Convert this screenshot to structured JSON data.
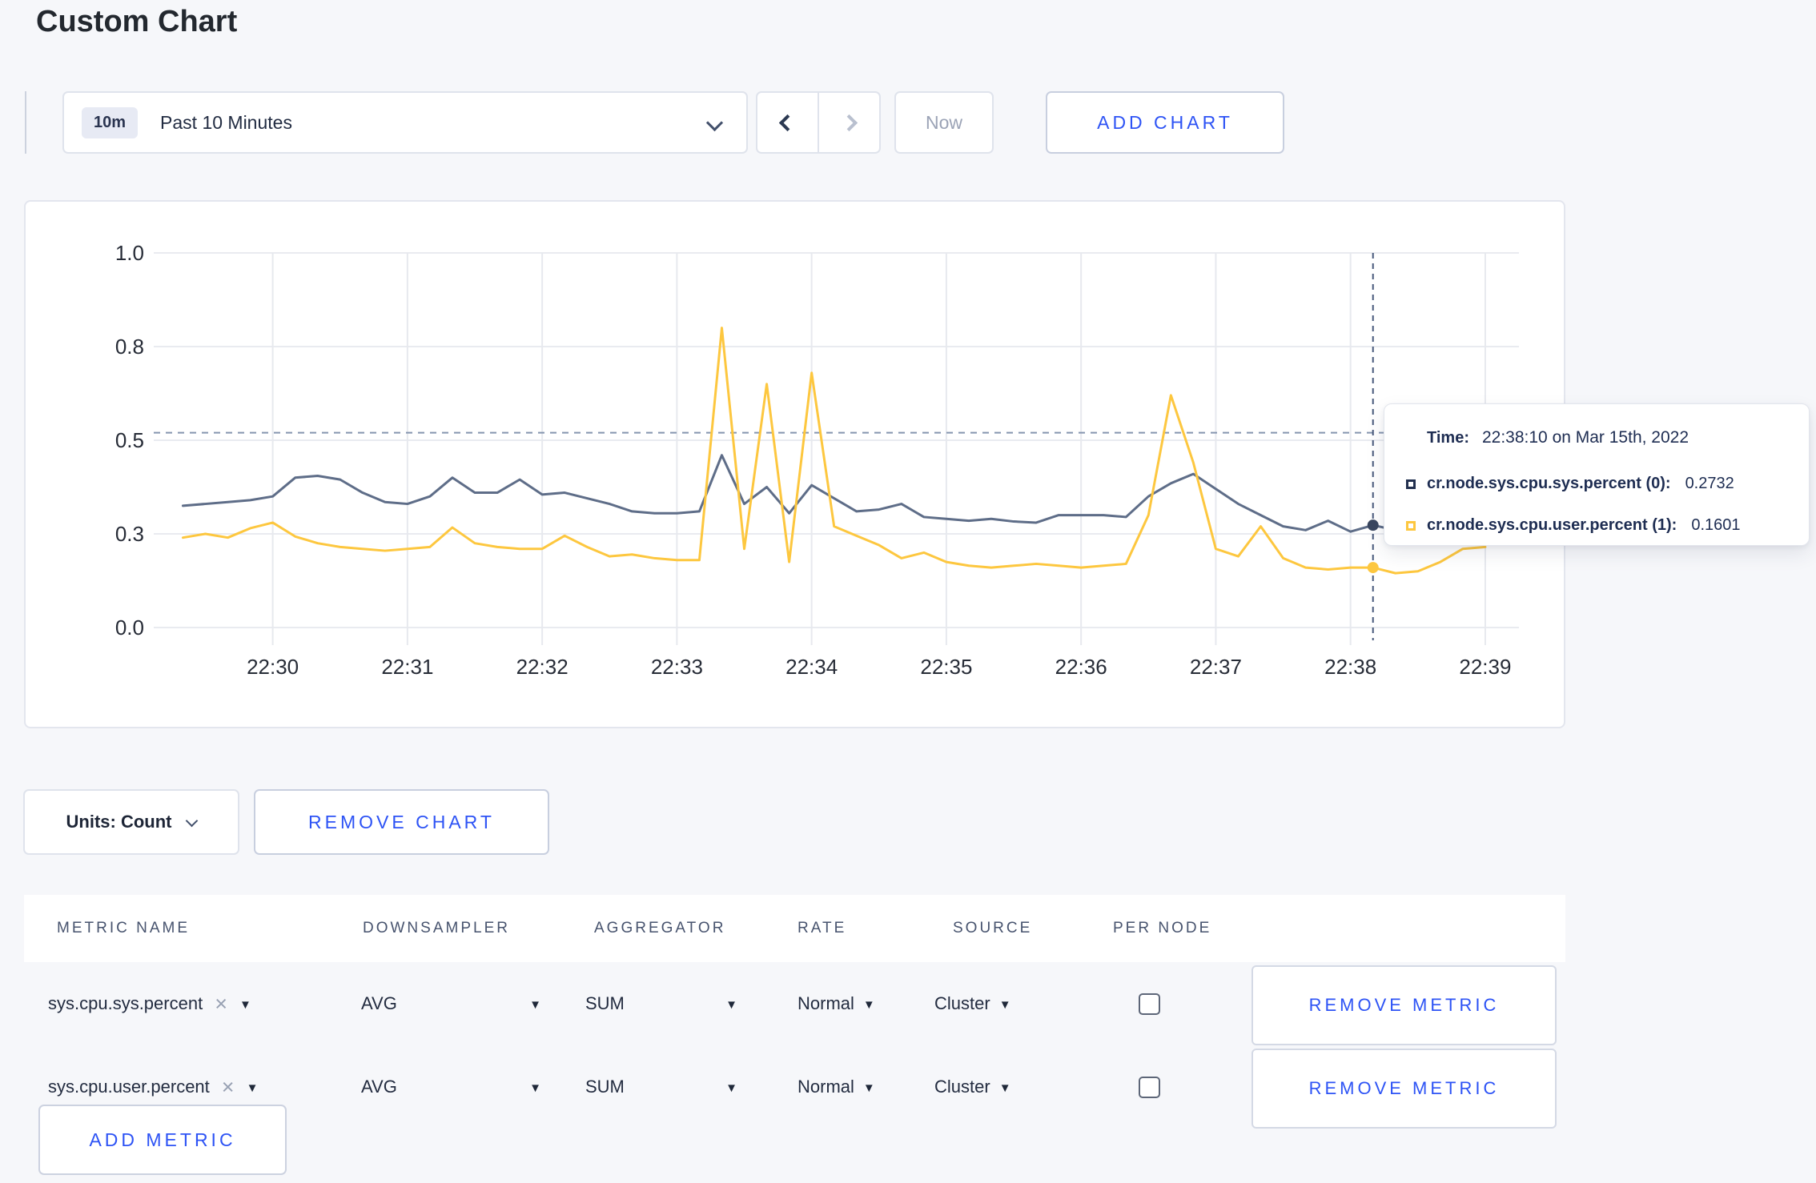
{
  "page": {
    "title": "Custom Chart",
    "background": "#f6f7fa",
    "accent_blue": "#2d53f5"
  },
  "icons": {
    "caret_down": "▼",
    "close": "×"
  },
  "toolbar": {
    "time_range": {
      "badge": "10m",
      "label": "Past 10 Minutes"
    },
    "now_label": "Now",
    "add_chart_label": "ADD CHART"
  },
  "chart_controls": {
    "units_label": "Units: Count",
    "remove_chart_label": "REMOVE CHART"
  },
  "tooltip": {
    "time_label": "Time:",
    "time_value": "22:38:10 on Mar 15th, 2022",
    "rows": [
      {
        "label": "cr.node.sys.cpu.sys.percent (0):",
        "value": "0.2732",
        "swatch_color": "#22304f"
      },
      {
        "label": "cr.node.sys.cpu.user.percent (1):",
        "value": "0.1601",
        "swatch_color": "#fdc73f"
      }
    ]
  },
  "chart_data": {
    "type": "line",
    "title": "",
    "xlabel": "",
    "ylabel": "",
    "grid": true,
    "legend_position": "tooltip",
    "x_axis": {
      "base_time": "22:29:00",
      "domain_seconds": [
        7,
        615
      ],
      "ticks": [
        {
          "s": 60,
          "label": "22:30"
        },
        {
          "s": 120,
          "label": "22:31"
        },
        {
          "s": 180,
          "label": "22:32"
        },
        {
          "s": 240,
          "label": "22:33"
        },
        {
          "s": 300,
          "label": "22:34"
        },
        {
          "s": 360,
          "label": "22:35"
        },
        {
          "s": 420,
          "label": "22:36"
        },
        {
          "s": 480,
          "label": "22:37"
        },
        {
          "s": 540,
          "label": "22:38"
        },
        {
          "s": 600,
          "label": "22:39"
        }
      ]
    },
    "y_axis": {
      "domain": [
        0,
        1
      ],
      "ticks": [
        {
          "v": 0.0,
          "label": "0.0"
        },
        {
          "v": 0.25,
          "label": "0.3"
        },
        {
          "v": 0.5,
          "label": "0.5"
        },
        {
          "v": 0.75,
          "label": "0.8"
        },
        {
          "v": 1.0,
          "label": "1.0"
        }
      ]
    },
    "x_seconds": [
      20,
      30,
      40,
      50,
      60,
      70,
      80,
      90,
      100,
      110,
      120,
      130,
      140,
      150,
      160,
      170,
      180,
      190,
      200,
      210,
      220,
      230,
      240,
      250,
      260,
      270,
      280,
      290,
      300,
      310,
      320,
      330,
      340,
      350,
      360,
      370,
      380,
      390,
      400,
      410,
      420,
      430,
      440,
      450,
      460,
      470,
      480,
      490,
      500,
      510,
      520,
      530,
      540,
      550,
      560,
      570,
      580,
      590,
      600
    ],
    "series": [
      {
        "name": "cr.node.sys.cpu.sys.percent",
        "color": "#5e6d88",
        "values": [
          0.325,
          0.33,
          0.335,
          0.34,
          0.35,
          0.4,
          0.405,
          0.395,
          0.36,
          0.335,
          0.33,
          0.35,
          0.4,
          0.36,
          0.36,
          0.395,
          0.355,
          0.36,
          0.345,
          0.33,
          0.31,
          0.305,
          0.305,
          0.31,
          0.46,
          0.33,
          0.375,
          0.305,
          0.38,
          0.345,
          0.31,
          0.315,
          0.33,
          0.295,
          0.29,
          0.285,
          0.29,
          0.283,
          0.28,
          0.3,
          0.3,
          0.3,
          0.295,
          0.35,
          0.385,
          0.41,
          0.37,
          0.33,
          0.3,
          0.27,
          0.26,
          0.285,
          0.256,
          0.2732,
          0.26,
          0.27,
          0.28,
          0.29,
          0.3
        ]
      },
      {
        "name": "cr.node.sys.cpu.user.percent",
        "color": "#fdc73f",
        "values": [
          0.24,
          0.25,
          0.24,
          0.265,
          0.28,
          0.243,
          0.225,
          0.215,
          0.21,
          0.205,
          0.21,
          0.215,
          0.267,
          0.225,
          0.215,
          0.21,
          0.21,
          0.245,
          0.215,
          0.19,
          0.195,
          0.185,
          0.18,
          0.18,
          0.8,
          0.21,
          0.65,
          0.175,
          0.68,
          0.27,
          0.245,
          0.22,
          0.185,
          0.2,
          0.175,
          0.165,
          0.16,
          0.165,
          0.17,
          0.165,
          0.16,
          0.165,
          0.17,
          0.3,
          0.62,
          0.44,
          0.21,
          0.19,
          0.27,
          0.185,
          0.16,
          0.155,
          0.16,
          0.1601,
          0.145,
          0.15,
          0.175,
          0.21,
          0.215
        ]
      }
    ],
    "crosshair": {
      "x_seconds": 550,
      "time": "22:38:10",
      "hline_value": 0.52,
      "points": [
        {
          "value": 0.2732,
          "color": "#39465f"
        },
        {
          "value": 0.1601,
          "color": "#fdc73f"
        }
      ]
    }
  },
  "metrics_table": {
    "headers": [
      "METRIC NAME",
      "DOWNSAMPLER",
      "AGGREGATOR",
      "RATE",
      "SOURCE",
      "PER NODE"
    ],
    "rows": [
      {
        "name": "sys.cpu.sys.percent",
        "downsampler": "AVG",
        "aggregator": "SUM",
        "rate": "Normal",
        "source": "Cluster",
        "per_node_checked": false,
        "remove_label": "REMOVE METRIC"
      },
      {
        "name": "sys.cpu.user.percent",
        "downsampler": "AVG",
        "aggregator": "SUM",
        "rate": "Normal",
        "source": "Cluster",
        "per_node_checked": false,
        "remove_label": "REMOVE METRIC"
      }
    ],
    "add_metric_label": "ADD METRIC"
  }
}
